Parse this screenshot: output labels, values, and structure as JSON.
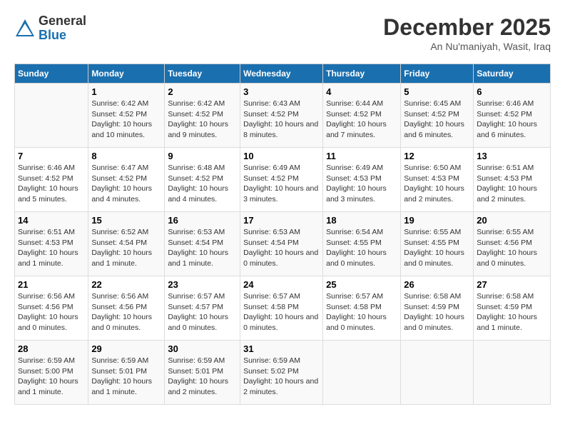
{
  "header": {
    "logo_general": "General",
    "logo_blue": "Blue",
    "month_title": "December 2025",
    "location": "An Nu'maniyah, Wasit, Iraq"
  },
  "columns": [
    "Sunday",
    "Monday",
    "Tuesday",
    "Wednesday",
    "Thursday",
    "Friday",
    "Saturday"
  ],
  "weeks": [
    [
      {
        "day": "",
        "sunrise": "",
        "sunset": "",
        "daylight": ""
      },
      {
        "day": "1",
        "sunrise": "Sunrise: 6:42 AM",
        "sunset": "Sunset: 4:52 PM",
        "daylight": "Daylight: 10 hours and 10 minutes."
      },
      {
        "day": "2",
        "sunrise": "Sunrise: 6:42 AM",
        "sunset": "Sunset: 4:52 PM",
        "daylight": "Daylight: 10 hours and 9 minutes."
      },
      {
        "day": "3",
        "sunrise": "Sunrise: 6:43 AM",
        "sunset": "Sunset: 4:52 PM",
        "daylight": "Daylight: 10 hours and 8 minutes."
      },
      {
        "day": "4",
        "sunrise": "Sunrise: 6:44 AM",
        "sunset": "Sunset: 4:52 PM",
        "daylight": "Daylight: 10 hours and 7 minutes."
      },
      {
        "day": "5",
        "sunrise": "Sunrise: 6:45 AM",
        "sunset": "Sunset: 4:52 PM",
        "daylight": "Daylight: 10 hours and 6 minutes."
      },
      {
        "day": "6",
        "sunrise": "Sunrise: 6:46 AM",
        "sunset": "Sunset: 4:52 PM",
        "daylight": "Daylight: 10 hours and 6 minutes."
      }
    ],
    [
      {
        "day": "7",
        "sunrise": "Sunrise: 6:46 AM",
        "sunset": "Sunset: 4:52 PM",
        "daylight": "Daylight: 10 hours and 5 minutes."
      },
      {
        "day": "8",
        "sunrise": "Sunrise: 6:47 AM",
        "sunset": "Sunset: 4:52 PM",
        "daylight": "Daylight: 10 hours and 4 minutes."
      },
      {
        "day": "9",
        "sunrise": "Sunrise: 6:48 AM",
        "sunset": "Sunset: 4:52 PM",
        "daylight": "Daylight: 10 hours and 4 minutes."
      },
      {
        "day": "10",
        "sunrise": "Sunrise: 6:49 AM",
        "sunset": "Sunset: 4:52 PM",
        "daylight": "Daylight: 10 hours and 3 minutes."
      },
      {
        "day": "11",
        "sunrise": "Sunrise: 6:49 AM",
        "sunset": "Sunset: 4:53 PM",
        "daylight": "Daylight: 10 hours and 3 minutes."
      },
      {
        "day": "12",
        "sunrise": "Sunrise: 6:50 AM",
        "sunset": "Sunset: 4:53 PM",
        "daylight": "Daylight: 10 hours and 2 minutes."
      },
      {
        "day": "13",
        "sunrise": "Sunrise: 6:51 AM",
        "sunset": "Sunset: 4:53 PM",
        "daylight": "Daylight: 10 hours and 2 minutes."
      }
    ],
    [
      {
        "day": "14",
        "sunrise": "Sunrise: 6:51 AM",
        "sunset": "Sunset: 4:53 PM",
        "daylight": "Daylight: 10 hours and 1 minute."
      },
      {
        "day": "15",
        "sunrise": "Sunrise: 6:52 AM",
        "sunset": "Sunset: 4:54 PM",
        "daylight": "Daylight: 10 hours and 1 minute."
      },
      {
        "day": "16",
        "sunrise": "Sunrise: 6:53 AM",
        "sunset": "Sunset: 4:54 PM",
        "daylight": "Daylight: 10 hours and 1 minute."
      },
      {
        "day": "17",
        "sunrise": "Sunrise: 6:53 AM",
        "sunset": "Sunset: 4:54 PM",
        "daylight": "Daylight: 10 hours and 0 minutes."
      },
      {
        "day": "18",
        "sunrise": "Sunrise: 6:54 AM",
        "sunset": "Sunset: 4:55 PM",
        "daylight": "Daylight: 10 hours and 0 minutes."
      },
      {
        "day": "19",
        "sunrise": "Sunrise: 6:55 AM",
        "sunset": "Sunset: 4:55 PM",
        "daylight": "Daylight: 10 hours and 0 minutes."
      },
      {
        "day": "20",
        "sunrise": "Sunrise: 6:55 AM",
        "sunset": "Sunset: 4:56 PM",
        "daylight": "Daylight: 10 hours and 0 minutes."
      }
    ],
    [
      {
        "day": "21",
        "sunrise": "Sunrise: 6:56 AM",
        "sunset": "Sunset: 4:56 PM",
        "daylight": "Daylight: 10 hours and 0 minutes."
      },
      {
        "day": "22",
        "sunrise": "Sunrise: 6:56 AM",
        "sunset": "Sunset: 4:56 PM",
        "daylight": "Daylight: 10 hours and 0 minutes."
      },
      {
        "day": "23",
        "sunrise": "Sunrise: 6:57 AM",
        "sunset": "Sunset: 4:57 PM",
        "daylight": "Daylight: 10 hours and 0 minutes."
      },
      {
        "day": "24",
        "sunrise": "Sunrise: 6:57 AM",
        "sunset": "Sunset: 4:58 PM",
        "daylight": "Daylight: 10 hours and 0 minutes."
      },
      {
        "day": "25",
        "sunrise": "Sunrise: 6:57 AM",
        "sunset": "Sunset: 4:58 PM",
        "daylight": "Daylight: 10 hours and 0 minutes."
      },
      {
        "day": "26",
        "sunrise": "Sunrise: 6:58 AM",
        "sunset": "Sunset: 4:59 PM",
        "daylight": "Daylight: 10 hours and 0 minutes."
      },
      {
        "day": "27",
        "sunrise": "Sunrise: 6:58 AM",
        "sunset": "Sunset: 4:59 PM",
        "daylight": "Daylight: 10 hours and 1 minute."
      }
    ],
    [
      {
        "day": "28",
        "sunrise": "Sunrise: 6:59 AM",
        "sunset": "Sunset: 5:00 PM",
        "daylight": "Daylight: 10 hours and 1 minute."
      },
      {
        "day": "29",
        "sunrise": "Sunrise: 6:59 AM",
        "sunset": "Sunset: 5:01 PM",
        "daylight": "Daylight: 10 hours and 1 minute."
      },
      {
        "day": "30",
        "sunrise": "Sunrise: 6:59 AM",
        "sunset": "Sunset: 5:01 PM",
        "daylight": "Daylight: 10 hours and 2 minutes."
      },
      {
        "day": "31",
        "sunrise": "Sunrise: 6:59 AM",
        "sunset": "Sunset: 5:02 PM",
        "daylight": "Daylight: 10 hours and 2 minutes."
      },
      {
        "day": "",
        "sunrise": "",
        "sunset": "",
        "daylight": ""
      },
      {
        "day": "",
        "sunrise": "",
        "sunset": "",
        "daylight": ""
      },
      {
        "day": "",
        "sunrise": "",
        "sunset": "",
        "daylight": ""
      }
    ]
  ]
}
